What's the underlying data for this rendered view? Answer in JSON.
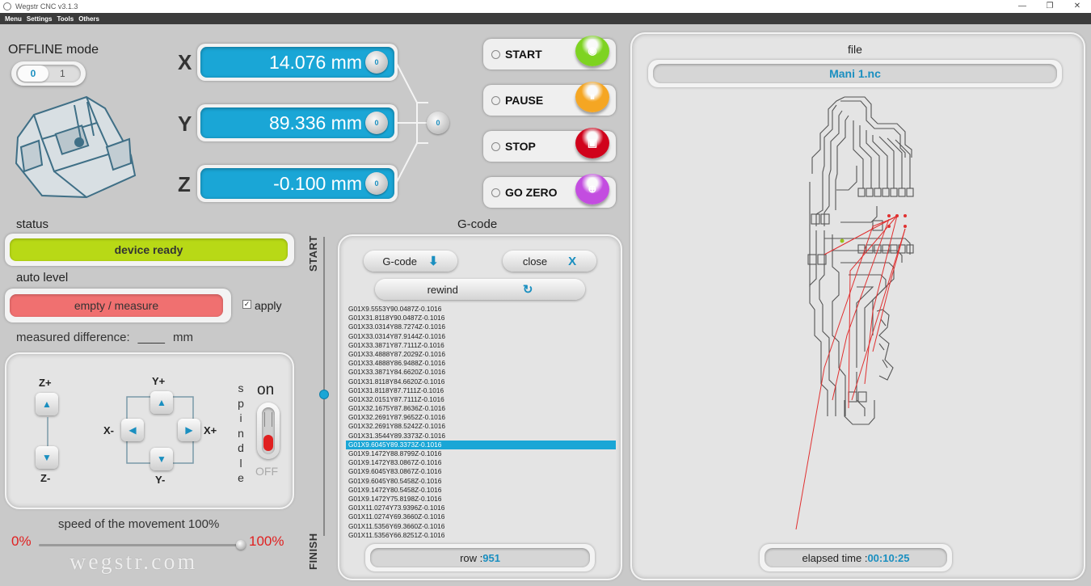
{
  "window": {
    "title": "Wegstr CNC  v3.1.3",
    "minimize": "—",
    "maximize": "❐",
    "close": "✕"
  },
  "menu": {
    "items": [
      "Menu",
      "Settings",
      "Tools",
      "Others"
    ]
  },
  "offline": {
    "title": "OFFLINE mode",
    "toggle_off": "0",
    "toggle_on": "1"
  },
  "axes": {
    "x": {
      "letter": "X",
      "value": "14.076 mm"
    },
    "y": {
      "letter": "Y",
      "value": "89.336 mm"
    },
    "z": {
      "letter": "Z",
      "value": "-0.100 mm"
    },
    "zero_glyph": "0"
  },
  "controls": {
    "start": "START",
    "pause": "PAUSE",
    "stop": "STOP",
    "go_zero": "GO ZERO",
    "colors": {
      "start": "#7ed321",
      "pause": "#f5a623",
      "stop": "#d0021b",
      "go_zero": "#c34de0"
    }
  },
  "status": {
    "title": "status",
    "value": "device ready",
    "color": "#b8d916"
  },
  "auto_level": {
    "title": "auto level",
    "button": "empty / measure",
    "apply_label": "apply",
    "apply_checked": true,
    "color": "#f07070"
  },
  "measured": {
    "label": "measured difference:",
    "value": "____",
    "unit": "mm"
  },
  "jog": {
    "z_plus": "Z+",
    "z_minus": "Z-",
    "y_plus": "Y+",
    "y_minus": "Y-",
    "x_plus": "X+",
    "x_minus": "X-",
    "spindle_label": "spindle",
    "spindle_on": "on",
    "spindle_off": "OFF"
  },
  "speed": {
    "label": "speed of the movement 100%",
    "min": "0%",
    "max": "100%",
    "value_percent": 100
  },
  "brand": "wegstr.com",
  "progress": {
    "start": "START",
    "finish": "FINISH"
  },
  "gcode": {
    "title": "G-code",
    "load_button": "G-code",
    "close_button": "close",
    "rewind_button": "rewind",
    "lines": [
      "G01X9.5553Y90.0487Z-0.1016",
      "G01X31.8118Y90.0487Z-0.1016",
      "G01X33.0314Y88.7274Z-0.1016",
      "G01X33.0314Y87.9144Z-0.1016",
      "G01X33.3871Y87.7111Z-0.1016",
      "G01X33.4888Y87.2029Z-0.1016",
      "G01X33.4888Y86.9488Z-0.1016",
      "G01X33.3871Y84.6620Z-0.1016",
      "G01X31.8118Y84.6620Z-0.1016",
      "G01X31.8118Y87.7111Z-0.1016",
      "G01X32.0151Y87.7111Z-0.1016",
      "G01X32.1675Y87.8636Z-0.1016",
      "G01X32.2691Y87.9652Z-0.1016",
      "G01X32.2691Y88.5242Z-0.1016",
      "G01X31.3544Y89.3373Z-0.1016",
      "G01X9.6045Y89.3373Z-0.1016",
      "G01X9.1472Y88.8799Z-0.1016",
      "G01X9.1472Y83.0867Z-0.1016",
      "G01X9.6045Y83.0867Z-0.1016",
      "G01X9.6045Y80.5458Z-0.1016",
      "G01X9.1472Y80.5458Z-0.1016",
      "G01X9.1472Y75.8198Z-0.1016",
      "G01X11.0274Y73.9396Z-0.1016",
      "G01X11.0274Y69.3660Z-0.1016",
      "G01X11.5356Y69.3660Z-0.1016",
      "G01X11.5356Y66.8251Z-0.1016"
    ],
    "selected_index": 15,
    "row_label": "row : ",
    "row_value": "951"
  },
  "file": {
    "title": "file",
    "name": "Mani 1.nc",
    "elapsed_label": "elapsed time : ",
    "elapsed_value": "00:10:25"
  }
}
